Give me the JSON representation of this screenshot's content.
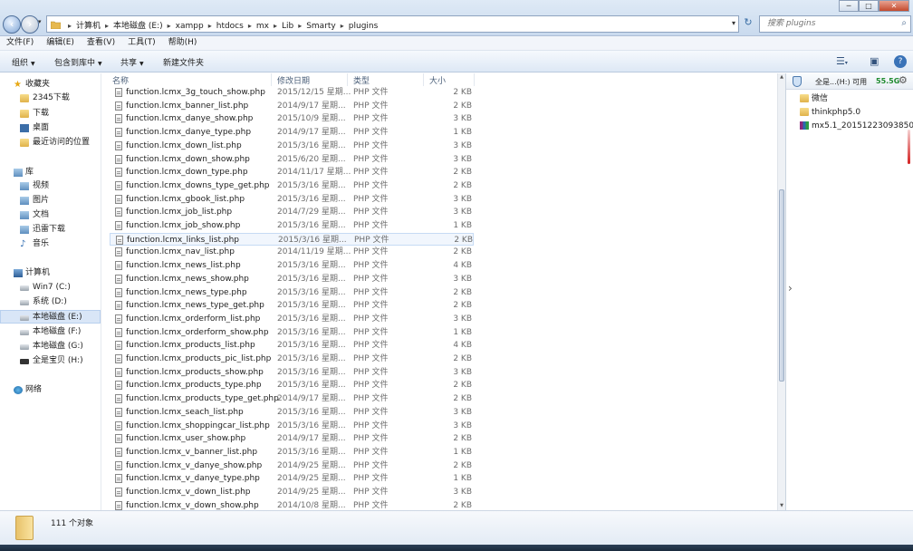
{
  "address": {
    "breadcrumbs": [
      "计算机",
      "本地磁盘 (E:)",
      "xampp",
      "htdocs",
      "mx",
      "Lib",
      "Smarty",
      "plugins"
    ],
    "search_placeholder": "搜索 plugins"
  },
  "window_controls": {
    "minimize": "─",
    "maximize": "□",
    "close": "✕"
  },
  "menubar": [
    "文件(F)",
    "编辑(E)",
    "查看(V)",
    "工具(T)",
    "帮助(H)"
  ],
  "toolbar": {
    "organize": "组织",
    "include_library": "包含到库中",
    "share": "共享",
    "new_folder": "新建文件夹"
  },
  "sidebar": {
    "favorites": {
      "label": "收藏夹",
      "items": [
        "2345下载",
        "下载",
        "桌面",
        "最近访问的位置"
      ]
    },
    "libraries": {
      "label": "库",
      "items": [
        "视频",
        "图片",
        "文档",
        "迅雷下载",
        "音乐"
      ]
    },
    "computer": {
      "label": "计算机",
      "items": [
        "Win7 (C:)",
        "系统 (D:)",
        "本地磁盘 (E:)",
        "本地磁盘 (F:)",
        "本地磁盘 (G:)",
        "全是宝贝 (H:)"
      ],
      "selected": "本地磁盘 (E:)"
    },
    "network": {
      "label": "网络"
    }
  },
  "columns": {
    "name": "名称",
    "date": "修改日期",
    "type": "类型",
    "size": "大小"
  },
  "files": [
    {
      "name": "function.lcmx_3g_touch_show.php",
      "date": "2015/12/15 星期...",
      "type": "PHP 文件",
      "size": "2 KB"
    },
    {
      "name": "function.lcmx_banner_list.php",
      "date": "2014/9/17 星期...",
      "type": "PHP 文件",
      "size": "2 KB"
    },
    {
      "name": "function.lcmx_danye_show.php",
      "date": "2015/10/9 星期...",
      "type": "PHP 文件",
      "size": "3 KB"
    },
    {
      "name": "function.lcmx_danye_type.php",
      "date": "2014/9/17 星期...",
      "type": "PHP 文件",
      "size": "1 KB"
    },
    {
      "name": "function.lcmx_down_list.php",
      "date": "2015/3/16 星期...",
      "type": "PHP 文件",
      "size": "3 KB"
    },
    {
      "name": "function.lcmx_down_show.php",
      "date": "2015/6/20 星期...",
      "type": "PHP 文件",
      "size": "3 KB"
    },
    {
      "name": "function.lcmx_down_type.php",
      "date": "2014/11/17 星期...",
      "type": "PHP 文件",
      "size": "2 KB"
    },
    {
      "name": "function.lcmx_downs_type_get.php",
      "date": "2015/3/16 星期...",
      "type": "PHP 文件",
      "size": "2 KB"
    },
    {
      "name": "function.lcmx_gbook_list.php",
      "date": "2015/3/16 星期...",
      "type": "PHP 文件",
      "size": "3 KB"
    },
    {
      "name": "function.lcmx_job_list.php",
      "date": "2014/7/29 星期...",
      "type": "PHP 文件",
      "size": "3 KB"
    },
    {
      "name": "function.lcmx_job_show.php",
      "date": "2015/3/16 星期...",
      "type": "PHP 文件",
      "size": "1 KB"
    },
    {
      "name": "function.lcmx_links_list.php",
      "date": "2015/3/16 星期...",
      "type": "PHP 文件",
      "size": "2 KB"
    },
    {
      "name": "function.lcmx_nav_list.php",
      "date": "2014/11/19 星期...",
      "type": "PHP 文件",
      "size": "2 KB"
    },
    {
      "name": "function.lcmx_news_list.php",
      "date": "2015/3/16 星期...",
      "type": "PHP 文件",
      "size": "4 KB"
    },
    {
      "name": "function.lcmx_news_show.php",
      "date": "2015/3/16 星期...",
      "type": "PHP 文件",
      "size": "3 KB"
    },
    {
      "name": "function.lcmx_news_type.php",
      "date": "2015/3/16 星期...",
      "type": "PHP 文件",
      "size": "2 KB"
    },
    {
      "name": "function.lcmx_news_type_get.php",
      "date": "2015/3/16 星期...",
      "type": "PHP 文件",
      "size": "2 KB"
    },
    {
      "name": "function.lcmx_orderform_list.php",
      "date": "2015/3/16 星期...",
      "type": "PHP 文件",
      "size": "3 KB"
    },
    {
      "name": "function.lcmx_orderform_show.php",
      "date": "2015/3/16 星期...",
      "type": "PHP 文件",
      "size": "1 KB"
    },
    {
      "name": "function.lcmx_products_list.php",
      "date": "2015/3/16 星期...",
      "type": "PHP 文件",
      "size": "4 KB"
    },
    {
      "name": "function.lcmx_products_pic_list.php",
      "date": "2015/3/16 星期...",
      "type": "PHP 文件",
      "size": "2 KB"
    },
    {
      "name": "function.lcmx_products_show.php",
      "date": "2015/3/16 星期...",
      "type": "PHP 文件",
      "size": "3 KB"
    },
    {
      "name": "function.lcmx_products_type.php",
      "date": "2015/3/16 星期...",
      "type": "PHP 文件",
      "size": "2 KB"
    },
    {
      "name": "function.lcmx_products_type_get.php",
      "date": "2014/9/17 星期...",
      "type": "PHP 文件",
      "size": "2 KB"
    },
    {
      "name": "function.lcmx_seach_list.php",
      "date": "2015/3/16 星期...",
      "type": "PHP 文件",
      "size": "3 KB"
    },
    {
      "name": "function.lcmx_shoppingcar_list.php",
      "date": "2015/3/16 星期...",
      "type": "PHP 文件",
      "size": "3 KB"
    },
    {
      "name": "function.lcmx_user_show.php",
      "date": "2014/9/17 星期...",
      "type": "PHP 文件",
      "size": "2 KB"
    },
    {
      "name": "function.lcmx_v_banner_list.php",
      "date": "2015/3/16 星期...",
      "type": "PHP 文件",
      "size": "1 KB"
    },
    {
      "name": "function.lcmx_v_danye_show.php",
      "date": "2014/9/25 星期...",
      "type": "PHP 文件",
      "size": "2 KB"
    },
    {
      "name": "function.lcmx_v_danye_type.php",
      "date": "2014/9/25 星期...",
      "type": "PHP 文件",
      "size": "1 KB"
    },
    {
      "name": "function.lcmx_v_down_list.php",
      "date": "2014/9/25 星期...",
      "type": "PHP 文件",
      "size": "3 KB"
    },
    {
      "name": "function.lcmx_v_down_show.php",
      "date": "2014/10/8 星期...",
      "type": "PHP 文件",
      "size": "2 KB"
    }
  ],
  "selected_file": "function.lcmx_links_list.php",
  "preview_pane": {
    "drive_label": "全是...(H:) 可用",
    "free_space": "55.5G",
    "items": [
      {
        "name": "微信",
        "icon": "folder-icon"
      },
      {
        "name": "thinkphp5.0",
        "icon": "folder-icon"
      },
      {
        "name": "mx5.1_20151223093850...",
        "icon": "rar-archive-icon"
      }
    ]
  },
  "status": {
    "count": "111 个对象"
  },
  "colors": {
    "selection": "#d9e6f7",
    "free_space": "#1e8a2e",
    "toolbar": "#dde8f5"
  }
}
